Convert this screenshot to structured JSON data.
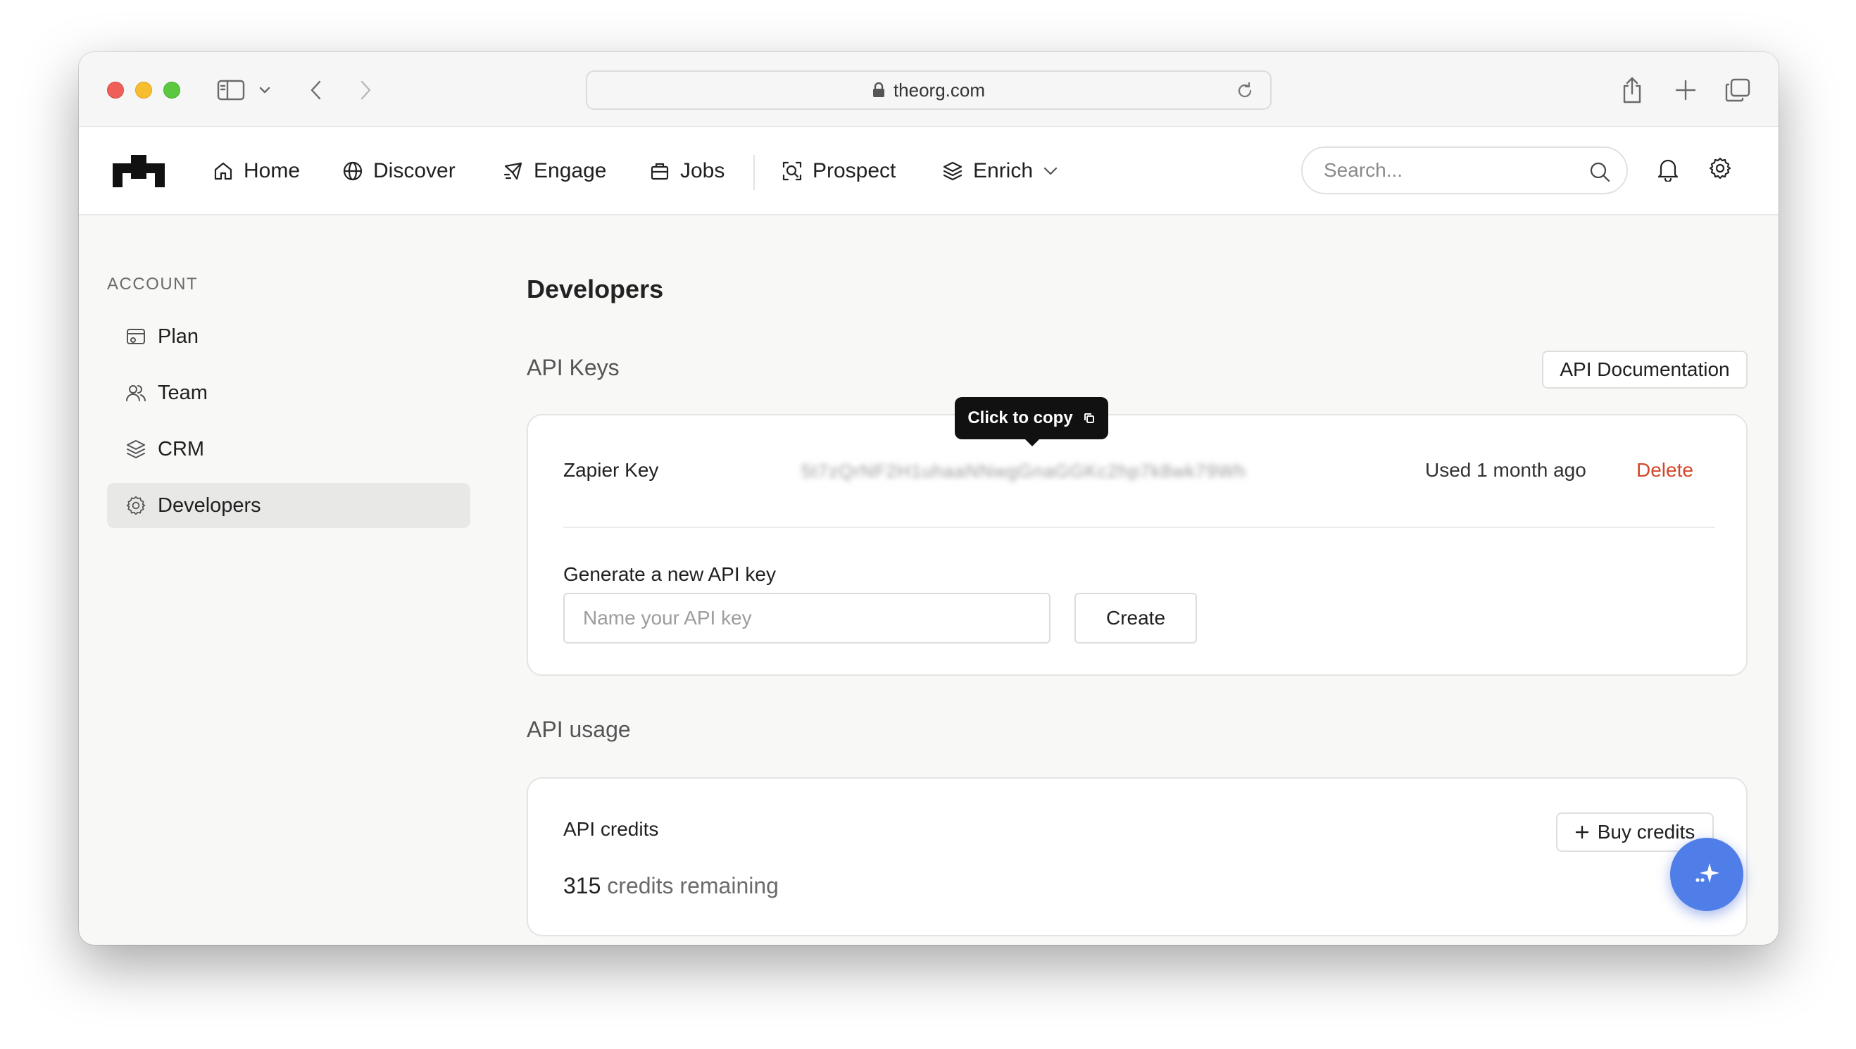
{
  "browser": {
    "url": "theorg.com"
  },
  "nav": {
    "items": [
      {
        "label": "Home",
        "icon": "home-icon"
      },
      {
        "label": "Discover",
        "icon": "globe-icon"
      },
      {
        "label": "Engage",
        "icon": "send-icon"
      },
      {
        "label": "Jobs",
        "icon": "briefcase-icon"
      },
      {
        "label": "Prospect",
        "icon": "scan-icon"
      },
      {
        "label": "Enrich",
        "icon": "layers-icon"
      }
    ],
    "search_placeholder": "Search..."
  },
  "sidebar": {
    "heading": "ACCOUNT",
    "items": [
      {
        "label": "Plan",
        "icon": "card-icon"
      },
      {
        "label": "Team",
        "icon": "team-icon"
      },
      {
        "label": "CRM",
        "icon": "layers-icon"
      },
      {
        "label": "Developers",
        "icon": "gear-icon",
        "active": true
      }
    ]
  },
  "main": {
    "title": "Developers",
    "api_keys": {
      "section_title": "API Keys",
      "doc_button": "API Documentation",
      "keys": [
        {
          "name": "Zapier Key",
          "value": "5t7zQrNF2H1uhaaNNwgGnaGGKc2hp7k8wk79Wh",
          "used": "Used 1 month ago",
          "delete_label": "Delete"
        }
      ],
      "tooltip": "Click to copy",
      "generate_label": "Generate a new API key",
      "input_placeholder": "Name your API key",
      "create_label": "Create"
    },
    "api_usage": {
      "section_title": "API usage",
      "credits_label": "API credits",
      "credits_number": "315",
      "credits_suffix": "credits remaining",
      "buy_label": "Buy credits"
    }
  },
  "colors": {
    "accent_fab": "#4f7ee8",
    "delete": "#d2472a"
  }
}
